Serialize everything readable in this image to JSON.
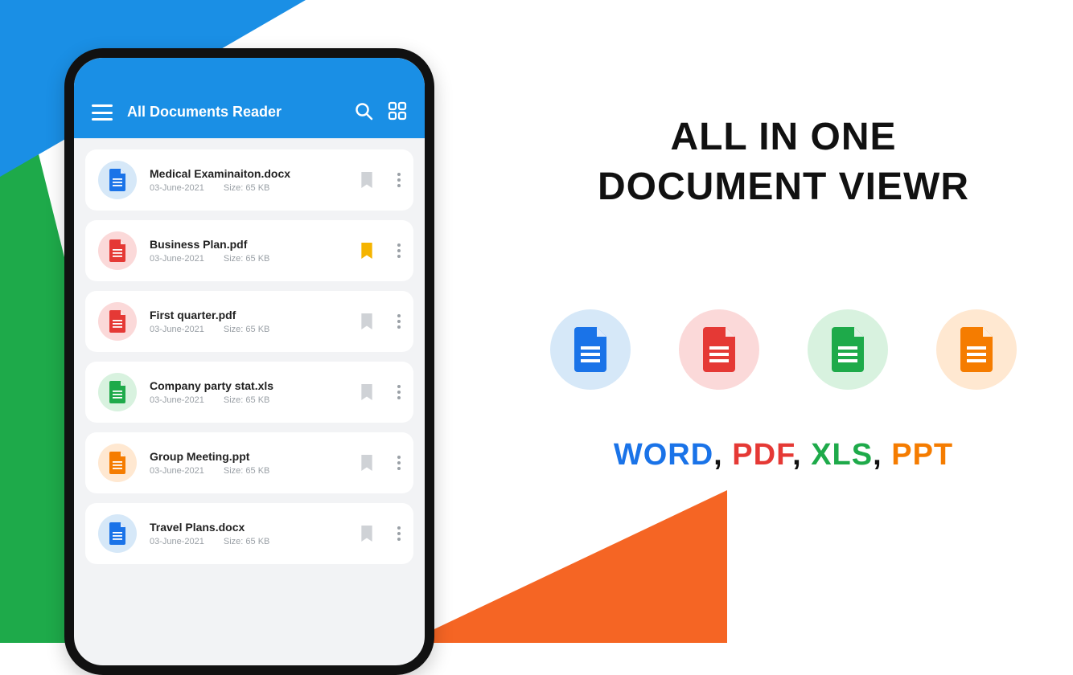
{
  "app": {
    "title": "All Documents Reader",
    "files": [
      {
        "name": "Medical Examinaiton.docx",
        "date": "03-June-2021",
        "size": "Size: 65 KB",
        "type": "word",
        "bookmarked": false
      },
      {
        "name": "Business Plan.pdf",
        "date": "03-June-2021",
        "size": "Size: 65 KB",
        "type": "pdf",
        "bookmarked": true
      },
      {
        "name": "First quarter.pdf",
        "date": "03-June-2021",
        "size": "Size: 65 KB",
        "type": "pdf",
        "bookmarked": false
      },
      {
        "name": "Company party stat.xls",
        "date": "03-June-2021",
        "size": "Size: 65 KB",
        "type": "xls",
        "bookmarked": false
      },
      {
        "name": "Group Meeting.ppt",
        "date": "03-June-2021",
        "size": "Size: 65 KB",
        "type": "ppt",
        "bookmarked": false
      },
      {
        "name": "Travel Plans.docx",
        "date": "03-June-2021",
        "size": "Size: 65 KB",
        "type": "word",
        "bookmarked": false
      }
    ]
  },
  "promo": {
    "heading_line1": "ALL IN ONE",
    "heading_line2": "DOCUMENT VIEWR",
    "formats": {
      "word": "WORD",
      "pdf": "PDF",
      "xls": "XLS",
      "ppt": "PPT"
    }
  },
  "colorMap": {
    "word": {
      "bg": "bg-blue",
      "fg": "c-blue"
    },
    "pdf": {
      "bg": "bg-red",
      "fg": "c-red"
    },
    "xls": {
      "bg": "bg-green",
      "fg": "c-green"
    },
    "ppt": {
      "bg": "bg-orange",
      "fg": "c-orange"
    }
  }
}
